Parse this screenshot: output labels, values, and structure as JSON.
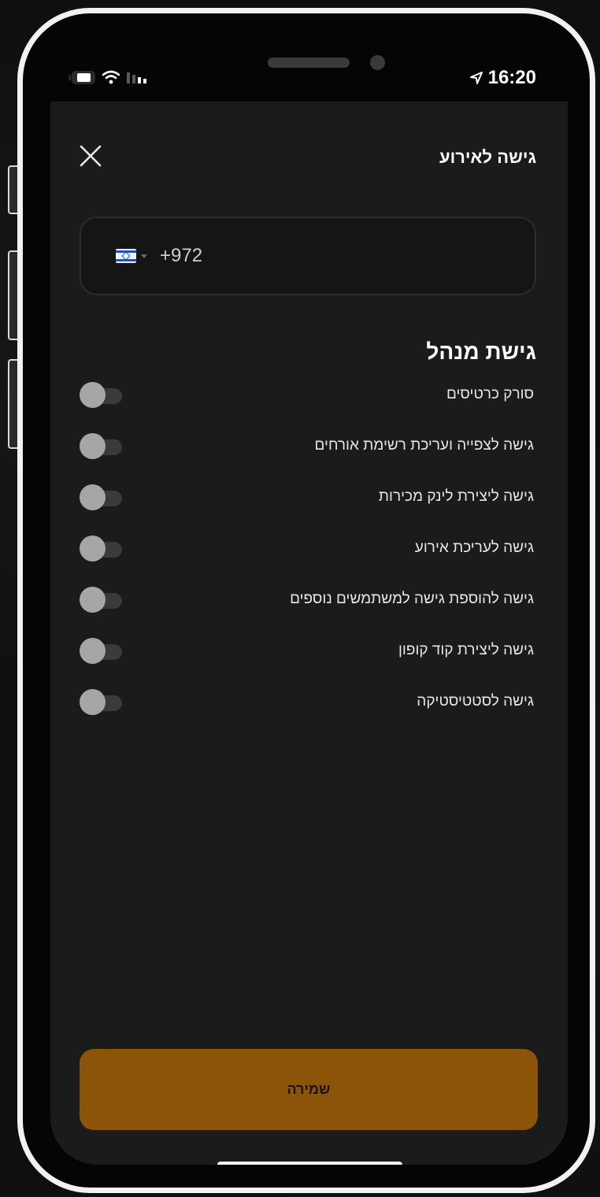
{
  "status_bar": {
    "time": "16:20",
    "icons": [
      "battery-icon",
      "wifi-icon",
      "signal-icon",
      "location-arrow-icon"
    ]
  },
  "header": {
    "title": "גישה לאירוע",
    "close_icon": "close-icon"
  },
  "phone_field": {
    "country_flag": "israel-flag-icon",
    "dial_code": "+972"
  },
  "permissions": {
    "section_title": "גישת מנהל",
    "items": [
      {
        "label": "סורק כרטיסים",
        "enabled": false
      },
      {
        "label": "גישה לצפייה ועריכת רשימת אורחים",
        "enabled": false
      },
      {
        "label": "גישה ליצירת לינק מכירות",
        "enabled": false
      },
      {
        "label": "גישה לעריכת אירוע",
        "enabled": false
      },
      {
        "label": "גישה להוספת גישה למשתמשים נוספים",
        "enabled": false
      },
      {
        "label": "גישה ליצירת קוד קופון",
        "enabled": false
      },
      {
        "label": "גישה לסטטיסטיקה",
        "enabled": false
      }
    ]
  },
  "footer": {
    "save_label": "שמירה"
  },
  "colors": {
    "screen_bg": "#1b1b1b",
    "accent_button": "#8c5409",
    "toggle_knob_off": "#a6a6a6",
    "toggle_track_off": "#3a3a3a"
  }
}
